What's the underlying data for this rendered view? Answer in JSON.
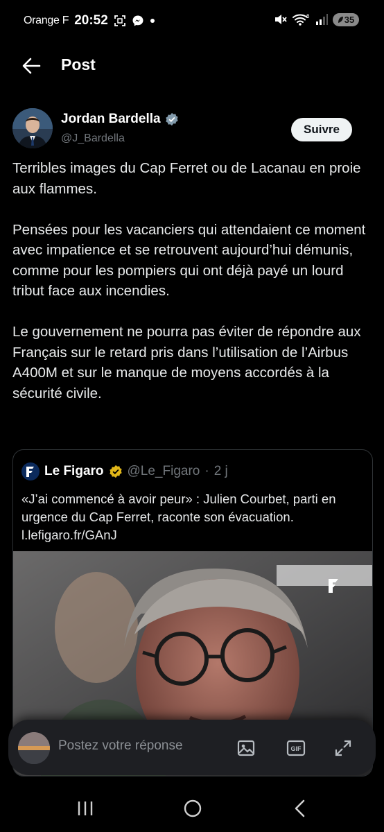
{
  "status_bar": {
    "carrier": "Orange F",
    "time": "20:52",
    "battery": "35",
    "wifi_badge": "6"
  },
  "header": {
    "title": "Post"
  },
  "author": {
    "name": "Jordan Bardella",
    "handle": "@J_Bardella",
    "follow_label": "Suivre"
  },
  "tweet": {
    "paragraphs": [
      "Terribles images du Cap Ferret ou de Lacanau en proie aux flammes.",
      "Pensées pour les vacanciers qui attendaient ce moment avec impatience et se retrouvent aujourd’hui démunis, comme pour les pompiers qui ont déjà payé un lourd tribut face aux incendies.",
      "Le gouvernement ne pourra pas éviter de répondre aux Français sur le retard pris dans l’utilisation de l’Airbus A400M et sur le manque de moyens accordés à la sécurité civile."
    ]
  },
  "quote": {
    "name": "Le Figaro",
    "handle": "@Le_Figaro",
    "separator": "·",
    "age": "2 j",
    "text": "«J’ai commencé à avoir peur» : Julien Courbet, parti en urgence du Cap Ferret, raconte son évacuation. l.lefigaro.fr/GAnJ"
  },
  "reply": {
    "placeholder": "Postez votre réponse",
    "gif_label": "GIF"
  },
  "colors": {
    "background": "#000000",
    "text": "#e7e9ea",
    "muted": "#71767b",
    "verified_gray": "#829aab",
    "verified_gold": "#e2b719",
    "follow_bg": "#eff3f4"
  },
  "icons": [
    "back-arrow-icon",
    "verified-badge-icon",
    "image-icon",
    "gif-icon",
    "expand-icon",
    "recents-icon",
    "home-icon",
    "nav-back-icon"
  ]
}
